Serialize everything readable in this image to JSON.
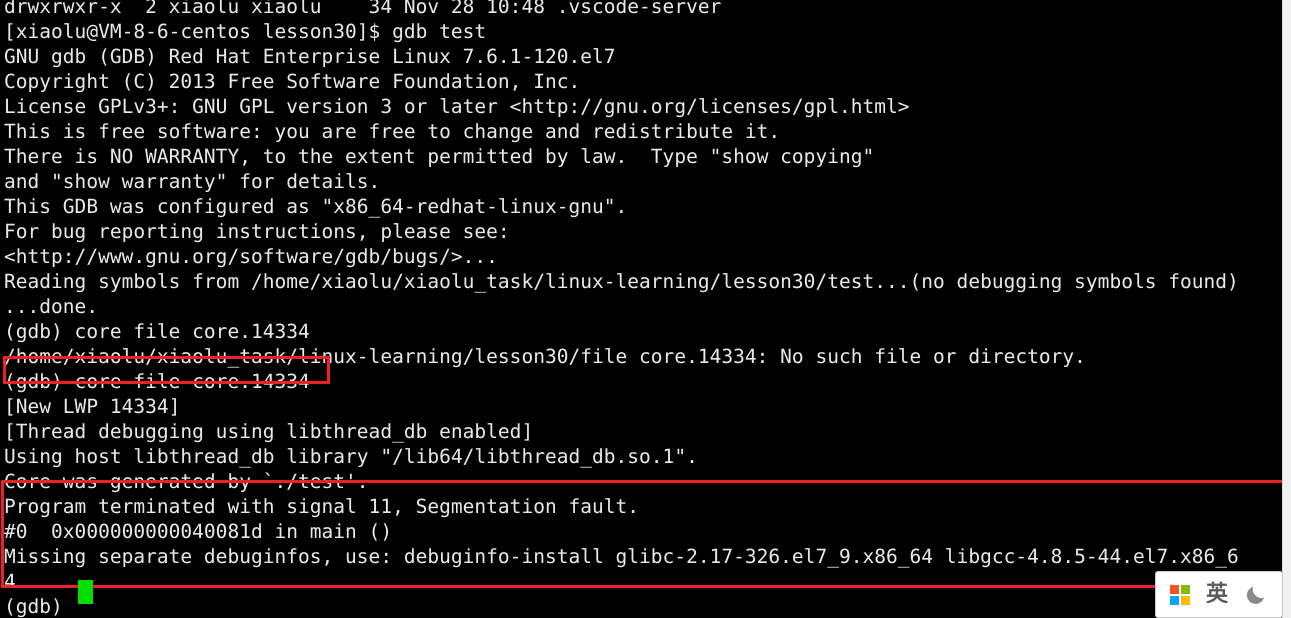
{
  "terminal": {
    "app": "gdb",
    "background_color": "#000000",
    "foreground_color": "#e8e8e8",
    "cursor_color": "#00e000",
    "annotation_color": "#ee2222",
    "lines": [
      "drwxrwxr-x  2 xiaolu xiaolu    34 Nov 28 10:48 .vscode-server",
      "[xiaolu@VM-8-6-centos lesson30]$ gdb test",
      "GNU gdb (GDB) Red Hat Enterprise Linux 7.6.1-120.el7",
      "Copyright (C) 2013 Free Software Foundation, Inc.",
      "License GPLv3+: GNU GPL version 3 or later <http://gnu.org/licenses/gpl.html>",
      "This is free software: you are free to change and redistribute it.",
      "There is NO WARRANTY, to the extent permitted by law.  Type \"show copying\"",
      "and \"show warranty\" for details.",
      "This GDB was configured as \"x86_64-redhat-linux-gnu\".",
      "For bug reporting instructions, please see:",
      "<http://www.gnu.org/software/gdb/bugs/>...",
      "Reading symbols from /home/xiaolu/xiaolu_task/linux-learning/lesson30/test...(no debugging symbols found)",
      "...done.",
      "(gdb) core file core.14334",
      "/home/xiaolu/xiaolu_task/linux-learning/lesson30/file core.14334: No such file or directory.",
      "(gdb) core-file core.14334",
      "[New LWP 14334]",
      "[Thread debugging using libthread_db enabled]",
      "Using host libthread_db library \"/lib64/libthread_db.so.1\".",
      "Core was generated by `./test'.",
      "Program terminated with signal 11, Segmentation fault.",
      "#0  0x000000000040081d in main ()",
      "Missing separate debuginfos, use: debuginfo-install glibc-2.17-326.el7_9.x86_64 libgcc-4.8.5-44.el7.x86_6",
      "4",
      "(gdb) "
    ]
  },
  "annotations": {
    "box_1_label": "highlight-core-file-command",
    "box_2_label": "highlight-segfault-backtrace"
  },
  "ime_bar": {
    "logo": "windows-logo-icon",
    "language": "英",
    "mode_icon": "moon-icon"
  }
}
